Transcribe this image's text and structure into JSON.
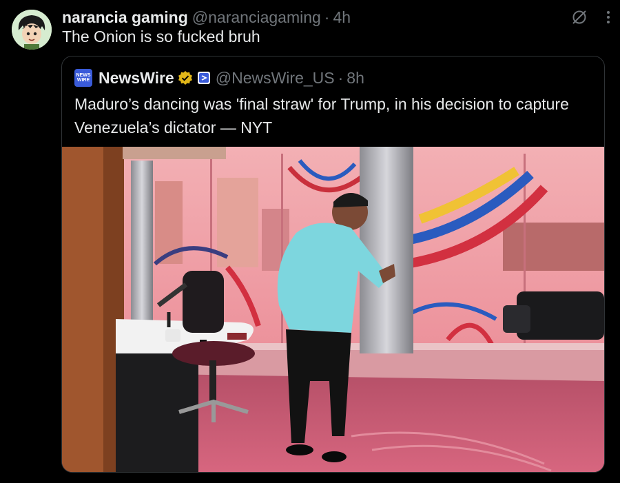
{
  "post": {
    "display_name": "narancia gaming",
    "handle": "@naranciagaming",
    "separator": "·",
    "time": "4h",
    "text": "The Onion is so fucked bruh",
    "avatar_icon": "anime-avatar",
    "top_icons": [
      "grok-icon",
      "more-icon"
    ]
  },
  "quote": {
    "logo_text_top": "NEWS",
    "logo_text_bottom": "WIRE",
    "display_name": "NewsWire",
    "verified_icon": "verified-badge-icon",
    "affiliate_icon": "affiliate-badge-icon",
    "handle": "@NewsWire_US",
    "separator": "·",
    "time": "8h",
    "text": "Maduro’s dancing was 'final straw' for Trump, in his decision to capture Venezuela’s dictator — NYT",
    "image_description_icon": "photo"
  },
  "colors": {
    "background": "#000000",
    "text": "#e7e9ea",
    "muted": "#71767b",
    "border": "#2f3336",
    "verified_gold": "#e2b719",
    "newswire_blue": "#3a5bd9"
  }
}
